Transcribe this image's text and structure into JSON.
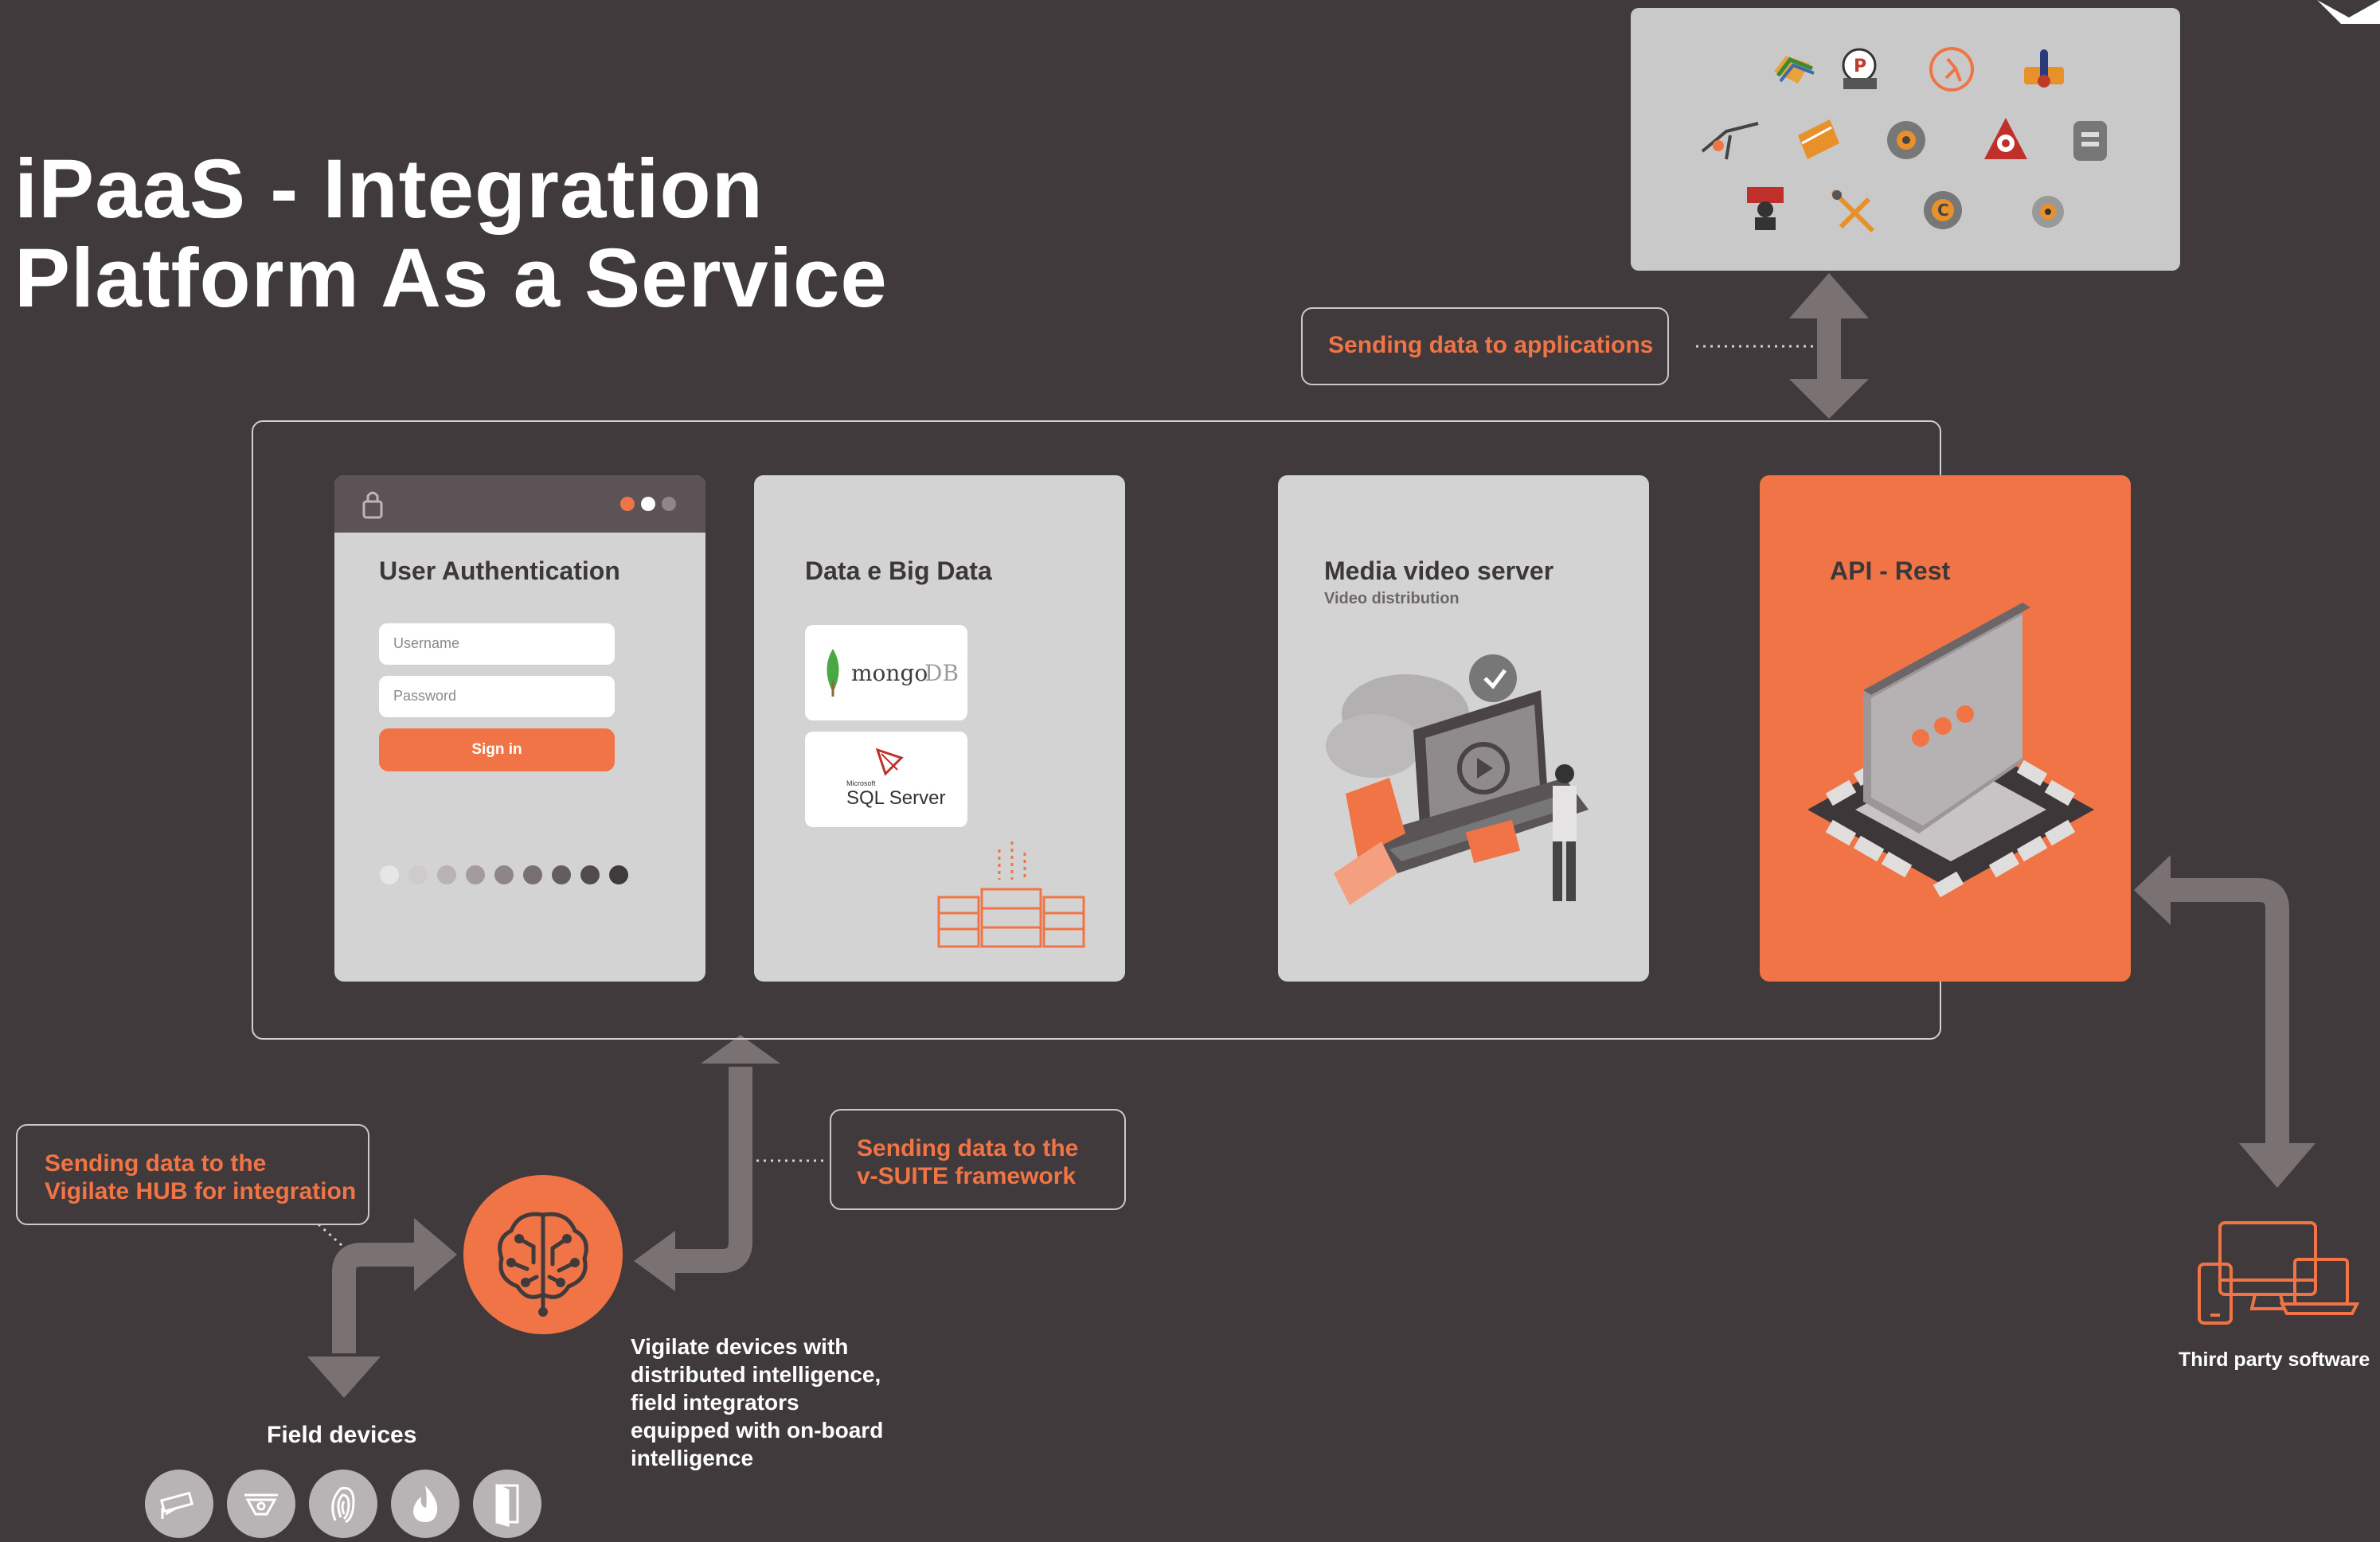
{
  "title": {
    "line1": "iPaaS - Integration",
    "line2": "Platform As a Service"
  },
  "callouts": {
    "applications": "Sending data to applications",
    "vsuite_line1": "Sending data to the",
    "vsuite_line2": "v-SUITE framework",
    "hub_line1": "Sending data to the",
    "hub_line2": "Vigilate HUB for integration"
  },
  "cards": {
    "auth": {
      "title": "User Authentication",
      "username_placeholder": "Username",
      "password_placeholder": "Password",
      "signin_label": "Sign in"
    },
    "data": {
      "title": "Data e Big Data",
      "mongo_label": "mongo",
      "mongo_db": "DB",
      "sql_small": "Microsoft",
      "sql_label": "SQL Server"
    },
    "media": {
      "title": "Media video server",
      "subtitle": "Video distribution"
    },
    "api": {
      "title": "API - Rest"
    }
  },
  "labels": {
    "field_devices": "Field devices",
    "vigilate_devices": [
      "Vigilate devices with",
      "distributed intelligence,",
      "field integrators",
      "equipped with on-board",
      "intelligence"
    ],
    "third_party": "Third party software"
  },
  "app_icons": [
    "flags-icon",
    "parking-icon",
    "runner-icon",
    "thermometer-icon",
    "antenna-icon",
    "notebook-icon",
    "gear-icon",
    "alarm-icon",
    "server-icon",
    "worker-icon",
    "tools-icon",
    "coin-gear-icon",
    "settings-icon"
  ],
  "field_device_icons": [
    "camera-icon",
    "dome-camera-icon",
    "fingerprint-icon",
    "fire-icon",
    "door-icon"
  ],
  "colors": {
    "background": "#403a3d",
    "accent": "#f07445",
    "card": "#d3d3d3",
    "arrow": "#7a7173"
  }
}
